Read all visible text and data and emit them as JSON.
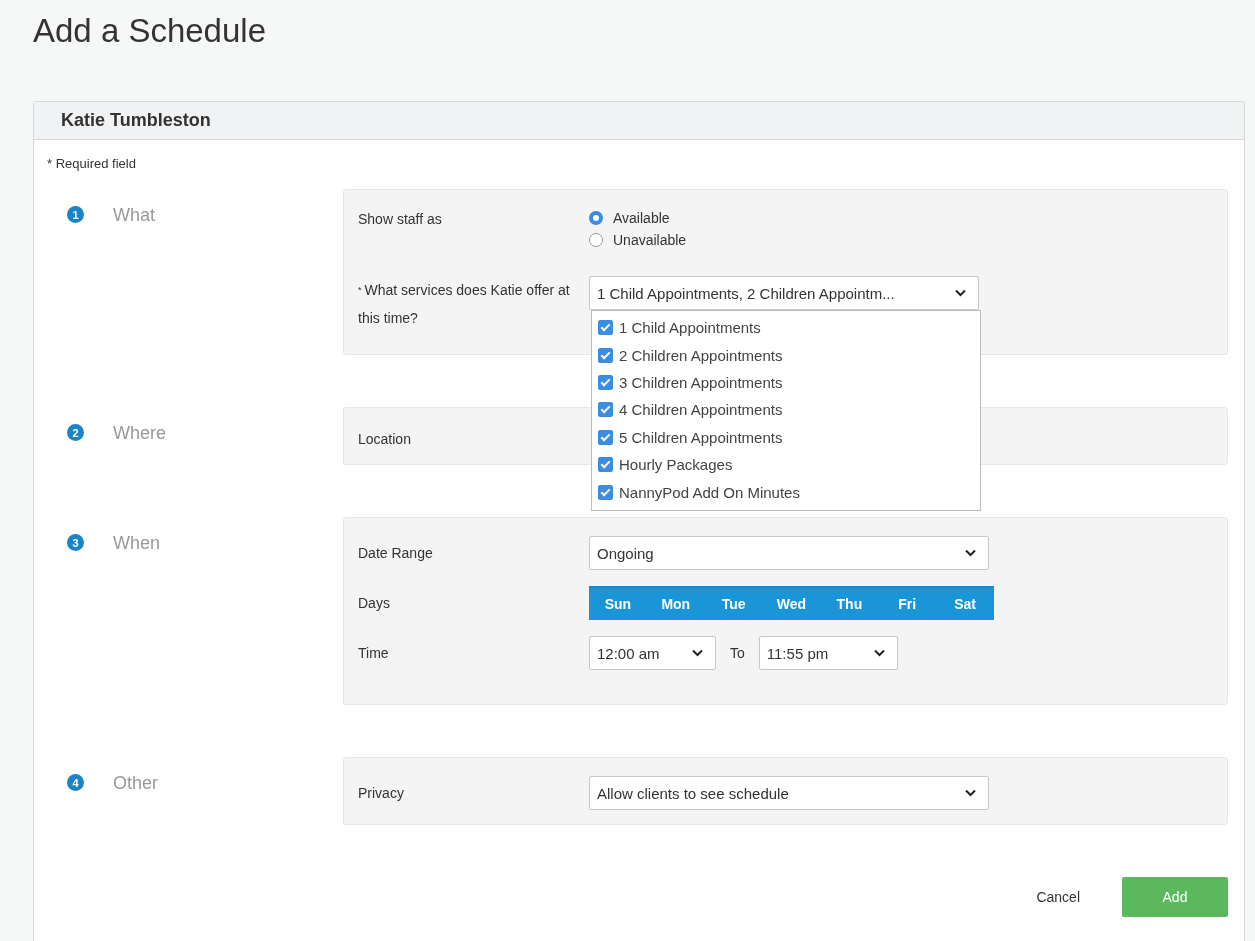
{
  "page_title": "Add a Schedule",
  "staff_name": "Katie Tumbleston",
  "required_note": "* Required field",
  "sections": [
    {
      "number": "1",
      "title": "What",
      "fields": [
        {
          "kind": "radio",
          "label": "Show staff as",
          "options": [
            {
              "label": "Available",
              "selected": true
            },
            {
              "label": "Unavailable",
              "selected": false
            }
          ]
        },
        {
          "kind": "multiselect",
          "required_mark": "*",
          "label": "What services does Katie offer at this time?",
          "value": "1 Child Appointments, 2 Children Appointm...",
          "expanded": true,
          "options": [
            {
              "label": "1 Child Appointments",
              "checked": true
            },
            {
              "label": "2 Children Appointments",
              "checked": true
            },
            {
              "label": "3 Children Appointments",
              "checked": true
            },
            {
              "label": "4 Children Appointments",
              "checked": true
            },
            {
              "label": "5 Children Appointments",
              "checked": true
            },
            {
              "label": "Hourly Packages",
              "checked": true
            },
            {
              "label": "NannyPod Add On Minutes",
              "checked": true
            }
          ]
        }
      ]
    },
    {
      "number": "2",
      "title": "Where",
      "fields": [
        {
          "kind": "plain",
          "label": "Location"
        }
      ]
    },
    {
      "number": "3",
      "title": "When",
      "fields": [
        {
          "kind": "select",
          "label": "Date Range",
          "value": "Ongoing"
        },
        {
          "kind": "days",
          "label": "Days",
          "days": [
            {
              "label": "Sun",
              "selected": true
            },
            {
              "label": "Mon",
              "selected": true
            },
            {
              "label": "Tue",
              "selected": true
            },
            {
              "label": "Wed",
              "selected": true
            },
            {
              "label": "Thu",
              "selected": true
            },
            {
              "label": "Fri",
              "selected": true
            },
            {
              "label": "Sat",
              "selected": true
            }
          ]
        },
        {
          "kind": "time_range",
          "label": "Time",
          "from": "12:00 am",
          "separator": "To",
          "to": "11:55 pm"
        }
      ]
    },
    {
      "number": "4",
      "title": "Other",
      "fields": [
        {
          "kind": "select",
          "label": "Privacy",
          "value": "Allow clients to see schedule"
        }
      ]
    }
  ],
  "footer": {
    "cancel": "Cancel",
    "submit": "Add"
  }
}
